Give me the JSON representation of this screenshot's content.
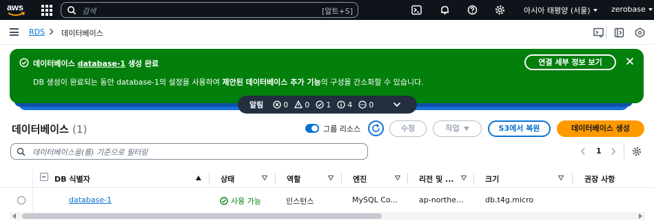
{
  "topnav": {
    "logo": "aws",
    "search_placeholder": "검색",
    "search_shortcut": "[알트+S]",
    "region": "아시아 태평양 (서울)",
    "user": "zerobase",
    "icons": [
      "services-grid-icon",
      "cloudshell-icon",
      "bell-icon",
      "help-icon",
      "settings-icon"
    ]
  },
  "breadcrumb": {
    "items": [
      "RDS",
      "데이터베이스"
    ]
  },
  "flash": {
    "title_prefix": "데이터베이스",
    "title_db": "database-1",
    "title_suffix": "생성 완료",
    "body_1": "DB 생성이 완료되는 동안 database-1의 설정을 사용하여",
    "body_bold": "제안된 데이터베이스 추가 기능",
    "body_2": "의 구성을 간소화할 수 있습니다.",
    "button": "연결 세부 정보 보기",
    "color": "#037f0c"
  },
  "notifications": {
    "label": "알림",
    "counts": [
      "0",
      "0",
      "1",
      "4",
      "0"
    ]
  },
  "table_header": {
    "title": "데이터베이스",
    "count": "(1)",
    "toggle_label": "그룹 리소스",
    "modify": "수정",
    "actions": "작업",
    "restore_s3": "S3에서 복원",
    "create": "데이터베이스 생성",
    "filter_placeholder": "데이터베이스을(를) 기준으로 필터링",
    "page": "1",
    "primary_color": "#ff9900"
  },
  "table": {
    "columns": [
      "DB 식별자",
      "상태",
      "역할",
      "엔진",
      "리전 및 ...",
      "크기",
      "권장 사항"
    ],
    "rows": [
      {
        "id": "database-1",
        "status": "사용 가능",
        "role": "인스턴스",
        "engine": "MySQL Co...",
        "region": "ap-northe...",
        "size": "db.t4g.micro",
        "recommendation": ""
      }
    ]
  }
}
